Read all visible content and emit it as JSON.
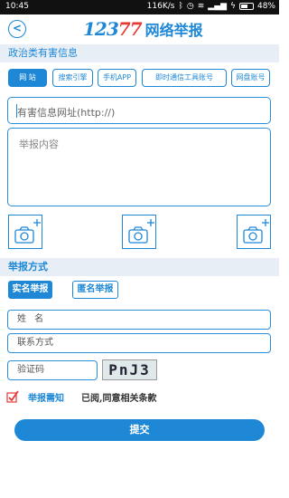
{
  "status_bar": {
    "time": "10:45",
    "network_speed": "116K/s",
    "battery": "48%"
  },
  "header": {
    "logo_number_blue": "123",
    "logo_number_red": "77",
    "title": "网络举报"
  },
  "section_harmful": {
    "title": "政治类有害信息",
    "tabs": [
      {
        "label": "网 站",
        "active": true
      },
      {
        "label": "搜索引擎",
        "active": false
      },
      {
        "label": "手机APP",
        "active": false
      },
      {
        "label": "即时通信工具账号",
        "active": false
      },
      {
        "label": "网盘账号",
        "active": false
      }
    ],
    "url_placeholder": "有害信息网址(http://)",
    "content_placeholder": "举报内容"
  },
  "section_method": {
    "title": "举报方式",
    "options": [
      {
        "label": "实名举报",
        "active": true
      },
      {
        "label": "匿名举报",
        "active": false
      }
    ],
    "name_placeholder": "姓 名",
    "contact_placeholder": "联系方式",
    "captcha_placeholder": "验证码",
    "captcha_code": "PnJ3"
  },
  "agreement": {
    "notice_link": "举报需知",
    "agree_text": "已阅,同意相关条款",
    "checked": true
  },
  "submit_label": "提交",
  "colors": {
    "accent": "#1e88d6",
    "logo_red": "#e53935",
    "section_bg": "#e8eef5"
  }
}
